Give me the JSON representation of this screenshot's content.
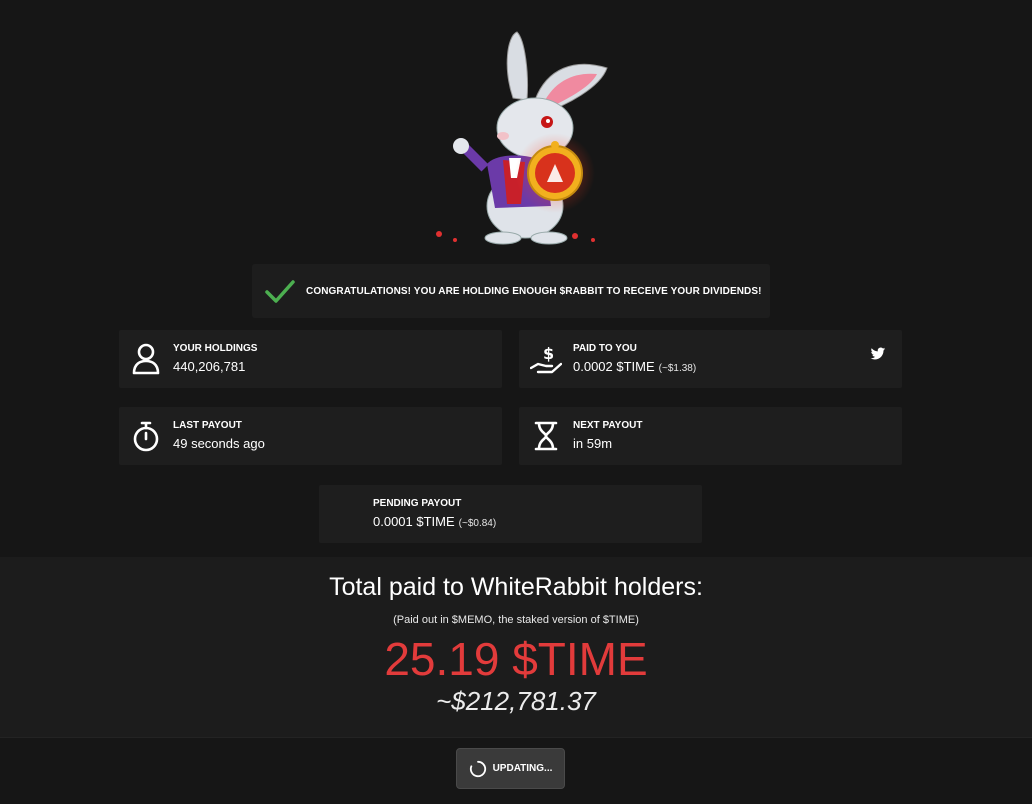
{
  "congrats": {
    "text": "CONGRATULATIONS! YOU ARE HOLDING ENOUGH $RABBIT TO RECEIVE YOUR DIVIDENDS!"
  },
  "cards": {
    "holdings": {
      "label": "YOUR HOLDINGS",
      "value": "440,206,781",
      "icon": "user-icon"
    },
    "paid": {
      "label": "PAID TO YOU",
      "value": "0.0002 $TIME",
      "sub": "(~$1.38)",
      "icon": "hand-dollar-icon",
      "share_icon": "twitter-icon"
    },
    "last": {
      "label": "LAST PAYOUT",
      "value": "49 seconds ago",
      "icon": "stopwatch-icon"
    },
    "next": {
      "label": "NEXT PAYOUT",
      "value": "in 59m",
      "icon": "hourglass-icon"
    },
    "pending": {
      "label": "PENDING PAYOUT",
      "value": "0.0001 $TIME",
      "sub": "(~$0.84)"
    }
  },
  "total": {
    "title": "Total paid to WhiteRabbit holders:",
    "subtitle": "(Paid out in $MEMO, the staked version of $TIME)",
    "amount": "25.19 $TIME",
    "usd": "~$212,781.37"
  },
  "button": {
    "label": "UPDATING..."
  },
  "colors": {
    "background": "#161616",
    "card": "#1e1e1e",
    "accent_red": "#e23b3b",
    "check_green": "#4caf50",
    "twitter": "#ffffff"
  }
}
